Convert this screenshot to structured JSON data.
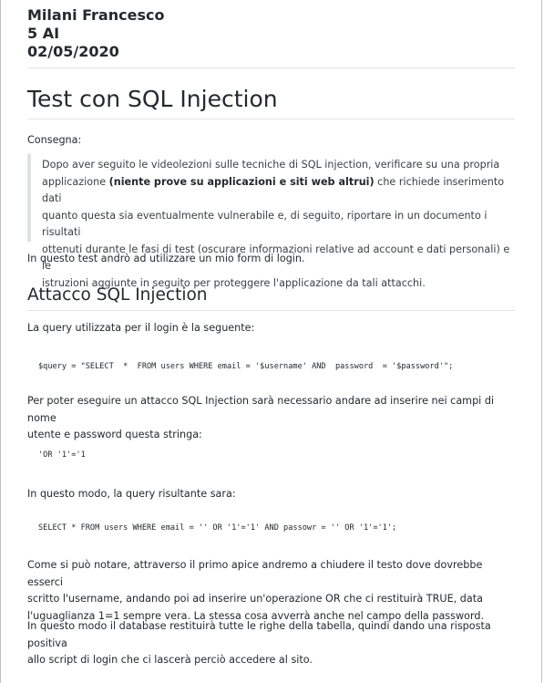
{
  "header": {
    "name": "Milani Francesco",
    "class": "5 AI",
    "date": "02/05/2020"
  },
  "title": "Test con SQL Injection",
  "consegna_label": "Consegna:",
  "quote": {
    "line1": "Dopo aver seguito le videolezioni sulle tecniche di SQL injection, verificare su una propria",
    "line2_pre": "applicazione ",
    "line2_bold": "(niente prove su applicazioni e siti web altrui)",
    "line2_post": " che richiede inserimento dati",
    "line3": "quanto questa sia eventualmente vulnerabile e, di seguito, riportare in un documento i risultati",
    "line4": "ottenuti durante le fasi di test (oscurare informazioni relative ad account e dati personali) e le",
    "line5": "istruzioni aggiunte in seguito per proteggere l'applicazione da tali attacchi."
  },
  "intro": "In questo test andrò ad utilizzare un mio form di login.",
  "section_title": "Attacco SQL Injection",
  "query_intro": "La query utilizzata per il login è la seguente:",
  "query_code": "$query = \"SELECT  *  FROM users WHERE email = '$username' AND  password  = '$password'\";",
  "attack_p1": "Per poter eseguire un attacco SQL Injection sarà necessario andare ad inserire nei campi di nome",
  "attack_p2": "utente e password questa stringa:",
  "attack_code": "'OR '1'='1",
  "result_intro": "In questo modo, la query risultante sara:",
  "result_code": "SELECT * FROM users WHERE email = '' OR '1'='1' AND passowr = '' OR '1'='1';",
  "explain_l1": "Come si può notare, attraverso il primo apice andremo a chiudere il testo dove dovrebbe esserci",
  "explain_l2": "scritto l'username, andando poi ad inserire un'operazione OR che ci restituirà TRUE, data",
  "explain_l3": "l'uguaglianza 1=1 sempre vera. La stessa cosa avverrà anche nel campo della password.",
  "final_l1": "In questo modo il database restituirà tutte le righe della tabella, quindi dando una risposta positiva",
  "final_l2": "allo script di login che ci lascerà perciò accedere al sito."
}
